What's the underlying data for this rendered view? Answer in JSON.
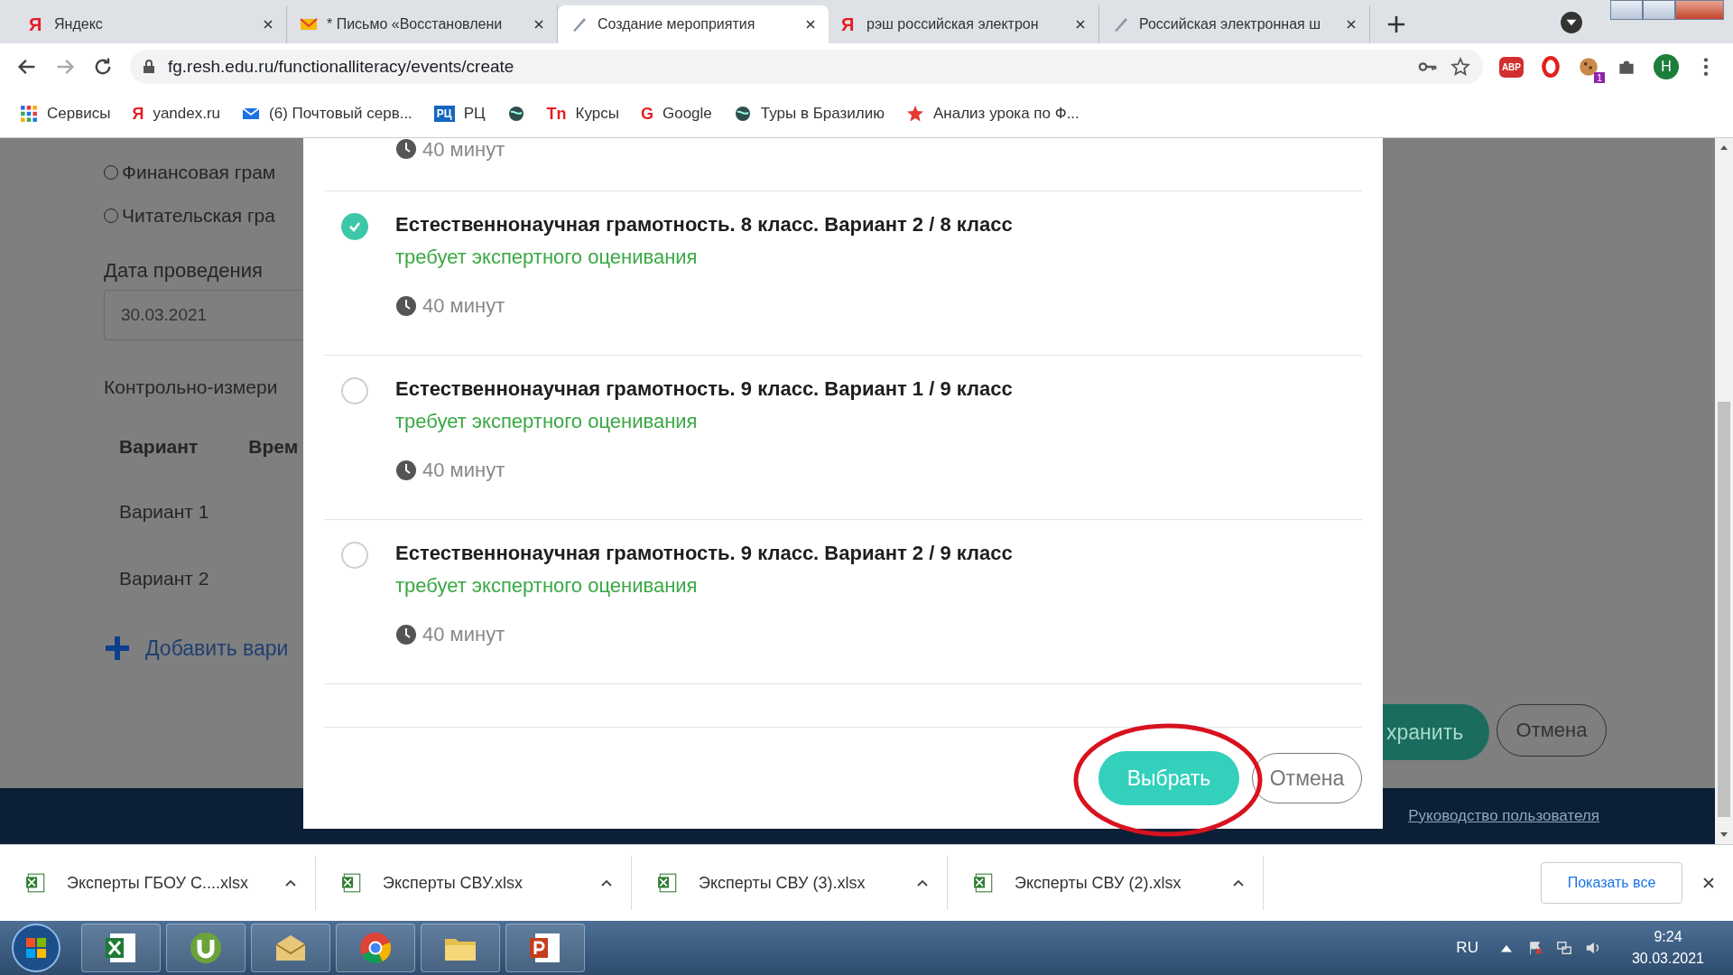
{
  "browser": {
    "tabs": [
      {
        "title": "Яндекс",
        "kind": "letter",
        "icon_text": "Я",
        "selected": false
      },
      {
        "title": "* Письмо «Восстановлени",
        "kind": "mail",
        "selected": false
      },
      {
        "title": "Создание мероприятия",
        "kind": "pen",
        "selected": true
      },
      {
        "title": "рэш российская электрон",
        "kind": "letter",
        "icon_text": "Я",
        "selected": false
      },
      {
        "title": "Российская электронная ш",
        "kind": "pen",
        "selected": false
      }
    ],
    "address": "fg.resh.edu.ru/functionalliteracy/events/create",
    "avatar": "Н",
    "abp": "ABP",
    "badge": "1",
    "bookmarks": [
      {
        "label": "Сервисы",
        "kind": "apps"
      },
      {
        "label": "yandex.ru",
        "kind": "letter",
        "icon_text": "Я"
      },
      {
        "label": "(6) Почтовый серв...",
        "kind": "mail"
      },
      {
        "label": "РЦ",
        "kind": "tag",
        "icon_text": "РЦ"
      },
      {
        "kind": "globe"
      },
      {
        "label": "Курсы",
        "kind": "letter",
        "icon_text": "Tn"
      },
      {
        "label": "Google",
        "kind": "letter",
        "icon_text": "G"
      },
      {
        "label": "Туры в Бразилию",
        "kind": "globe"
      },
      {
        "label": "Анализ урока по Ф...",
        "kind": "star"
      }
    ]
  },
  "page": {
    "radios": [
      {
        "label": "Финансовая грам",
        "selected": false
      },
      {
        "label": "Читательская гра",
        "selected": false
      }
    ],
    "date_label": "Дата проведения",
    "date_value": "30.03.2021",
    "kim_label": "Контрольно-измери",
    "columns": [
      "Вариант",
      "Врем"
    ],
    "rows": [
      "Вариант 1",
      "Вариант 2"
    ],
    "add_link": "Добавить вари",
    "save_button": "хранить",
    "cancel_button": "Отмена",
    "footer_link": "Руководство пользователя"
  },
  "dialog": {
    "top_duration": "40 минут",
    "items": [
      {
        "title": "Естественнонаучная грамотность. 8 класс. Вариант 2 / 8 класс",
        "note": "требует экспертного оценивания",
        "duration": "40 минут",
        "selected": true
      },
      {
        "title": "Естественнонаучная грамотность. 9 класс. Вариант 1 / 9 класс",
        "note": "требует экспертного оценивания",
        "duration": "40 минут",
        "selected": false
      },
      {
        "title": "Естественнонаучная грамотность. 9 класс. Вариант 2 / 9 класс",
        "note": "требует экспертного оценивания",
        "duration": "40 минут",
        "selected": false
      }
    ],
    "choose_button": "Выбрать",
    "cancel_button": "Отмена"
  },
  "downloads": {
    "files": [
      "Эксперты ГБОУ С....xlsx",
      "Эксперты СВУ.xlsx",
      "Эксперты СВУ (3).xlsx",
      "Эксперты СВУ (2).xlsx"
    ],
    "show_all": "Показать все"
  },
  "taskbar": {
    "lang": "RU",
    "time": "9:24",
    "date": "30.03.2021"
  }
}
